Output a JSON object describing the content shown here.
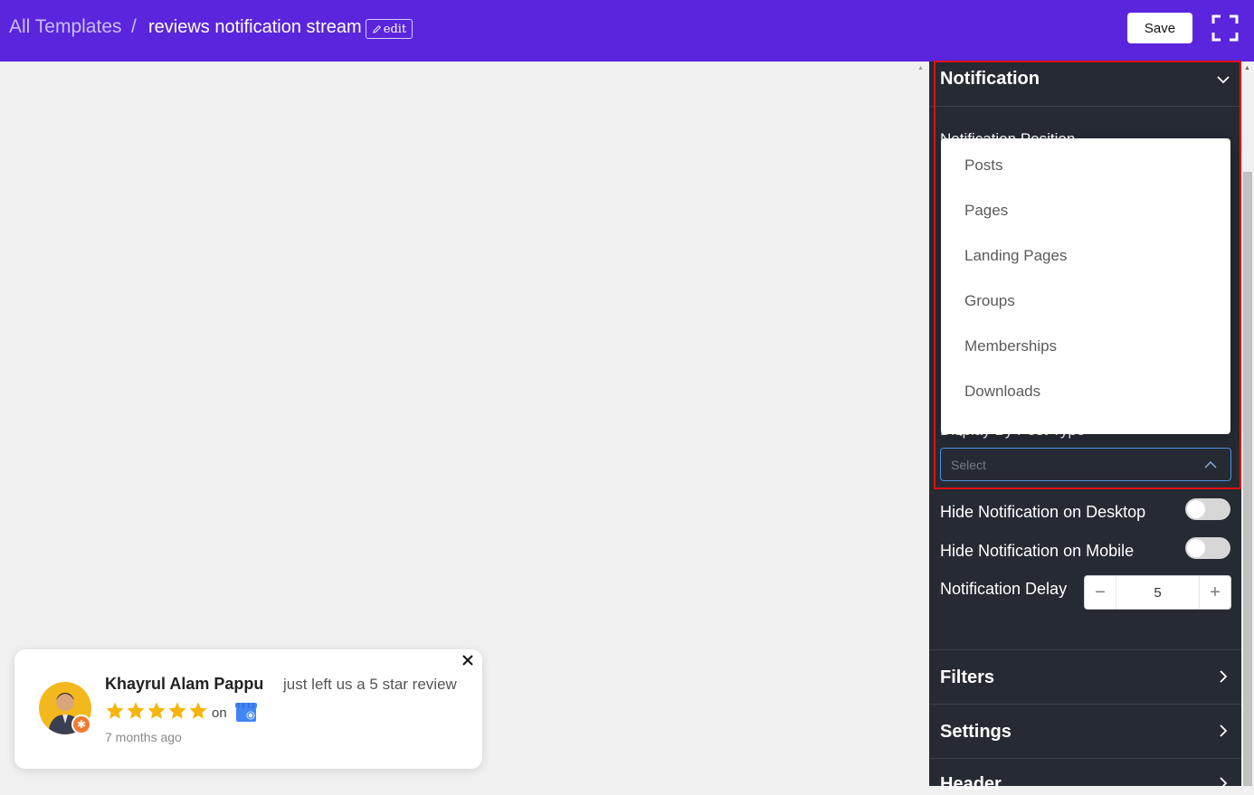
{
  "topbar": {
    "breadcrumb_root": "All Templates",
    "breadcrumb_separator": "/",
    "breadcrumb_current": "reviews notification stream",
    "edit_label": "edit",
    "save_label": "Save"
  },
  "toast": {
    "name": "Khayrul Alam Pappu",
    "action_text": "just left us a 5 star review",
    "rating": 5,
    "on_text": "on",
    "time_text": "7 months ago"
  },
  "panel": {
    "notification_header": "Notification",
    "partial_label_top": "Notification Position",
    "partial_label_bottom": "Display By Post Type",
    "dropdown_options": [
      "Posts",
      "Pages",
      "Landing Pages",
      "Groups",
      "Memberships",
      "Downloads"
    ],
    "select_placeholder": "Select",
    "hide_desktop_label": "Hide Notification on Desktop",
    "hide_mobile_label": "Hide Notification on Mobile",
    "delay_label": "Notification Delay",
    "delay_value": "5",
    "filters_label": "Filters",
    "settings_label": "Settings",
    "header_label": "Header"
  },
  "colors": {
    "topbar": "#5a25dc",
    "panel_bg": "#262a33",
    "highlight": "#e01010",
    "star": "#f5b50a"
  }
}
